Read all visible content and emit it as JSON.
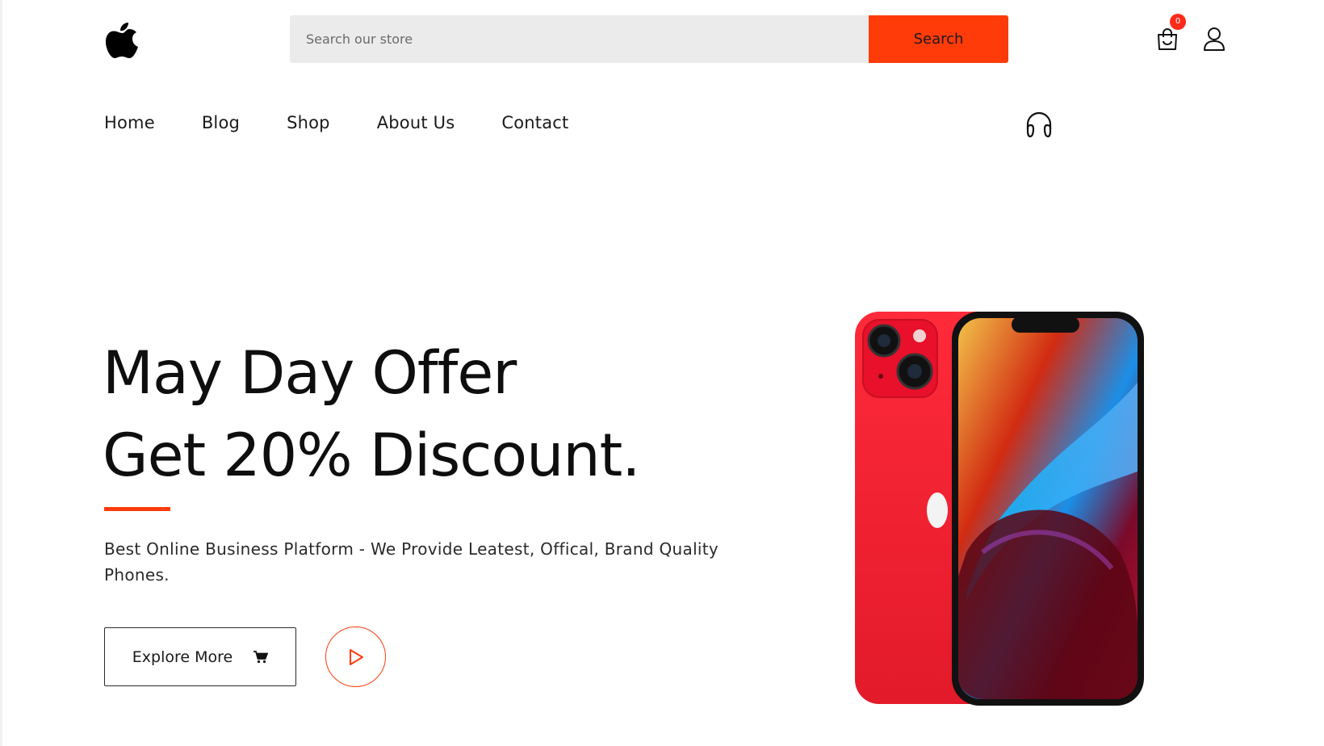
{
  "header": {
    "logo_icon": "apple-logo-icon",
    "search": {
      "placeholder": "Search our store",
      "button_label": "Search"
    },
    "cart": {
      "icon": "shopping-bag-icon",
      "count": "0"
    },
    "user_icon": "user-icon"
  },
  "nav": {
    "items": [
      {
        "label": "Home"
      },
      {
        "label": "Blog"
      },
      {
        "label": "Shop"
      },
      {
        "label": "About Us"
      },
      {
        "label": "Contact"
      }
    ],
    "support_icon": "headphones-icon"
  },
  "hero": {
    "title_line1": "May Day Offer",
    "title_line2": "Get 20% Discount.",
    "description": "Best Online Business Platform - We Provide Leatest, Offical, Brand Quality Phones.",
    "explore_label": "Explore More",
    "explore_icon": "cart-icon",
    "play_icon": "play-icon",
    "image": "red-smartphone-image"
  },
  "colors": {
    "accent": "#ff3b0a",
    "phone_red": "#e8102a"
  }
}
